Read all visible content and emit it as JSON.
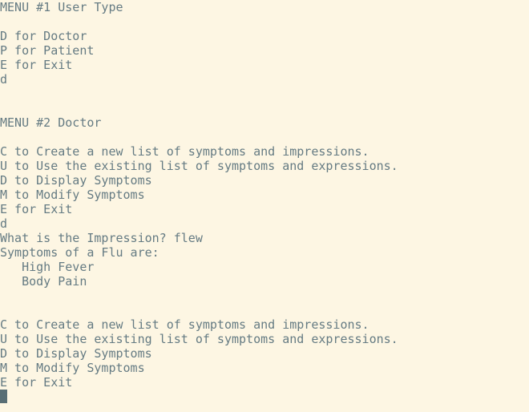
{
  "terminal": {
    "lines": [
      "MENU #1 User Type",
      "",
      "D for Doctor",
      "P for Patient",
      "E for Exit",
      "d",
      "",
      "",
      "MENU #2 Doctor",
      "",
      "C to Create a new list of symptoms and impressions.",
      "U to Use the existing list of symptoms and expressions.",
      "D to Display Symptoms",
      "M to Modify Symptoms",
      "E for Exit",
      "d",
      "What is the Impression? flew",
      "Symptoms of a Flu are:",
      "   High Fever",
      "   Body Pain",
      "",
      "",
      "C to Create a new list of symptoms and impressions.",
      "U to Use the existing list of symptoms and expressions.",
      "D to Display Symptoms",
      "M to Modify Symptoms",
      "E for Exit"
    ]
  },
  "colors": {
    "background": "#fdf6e3",
    "text": "#657b83",
    "cursor": "#586e75"
  }
}
